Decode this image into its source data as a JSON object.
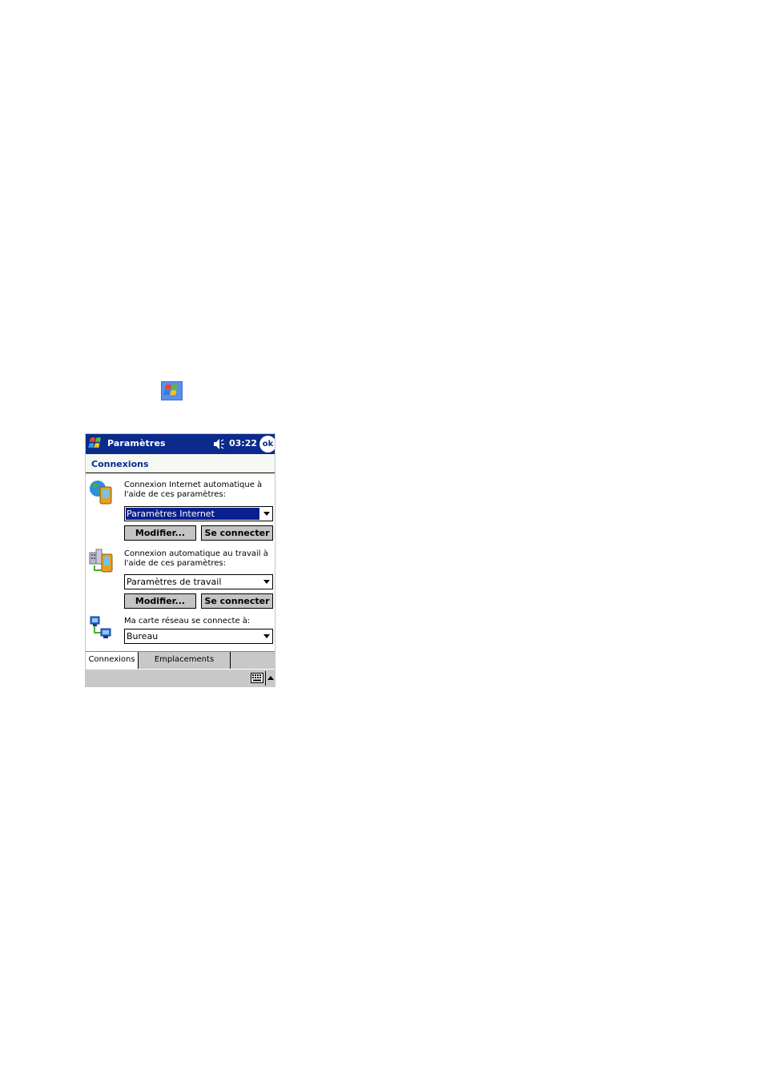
{
  "titlebar": {
    "title": "Paramètres",
    "clock": "03:22",
    "ok_label": "ok",
    "speaker_icon": "speaker-icon",
    "start_icon": "windows-flag-icon"
  },
  "section": {
    "title": "Connexions"
  },
  "internet": {
    "icon": "internet-connection-icon",
    "label": "Connexion Internet automatique à l'aide de ces paramètres:",
    "selected": "Paramètres Internet",
    "modify_label": "Modifier...",
    "connect_label": "Se connecter"
  },
  "work": {
    "icon": "work-connection-icon",
    "label": "Connexion automatique au travail à l'aide de ces paramètres:",
    "selected": "Paramètres de travail",
    "modify_label": "Modifier...",
    "connect_label": "Se connecter"
  },
  "network": {
    "icon": "network-card-icon",
    "label": "Ma carte réseau se connecte à:",
    "selected": "Bureau"
  },
  "tabs": [
    {
      "label": "Connexions",
      "active": true
    },
    {
      "label": "Emplacements d'appel",
      "active": false
    }
  ],
  "taskbar": {
    "keyboard_icon": "keyboard-icon",
    "sip_arrow_icon": "up-arrow-icon"
  },
  "colors": {
    "titlebar": "#0a2a8c",
    "selection": "#0a1f8f",
    "button_face": "#c4c4c4",
    "section_title": "#0a2a8c"
  }
}
